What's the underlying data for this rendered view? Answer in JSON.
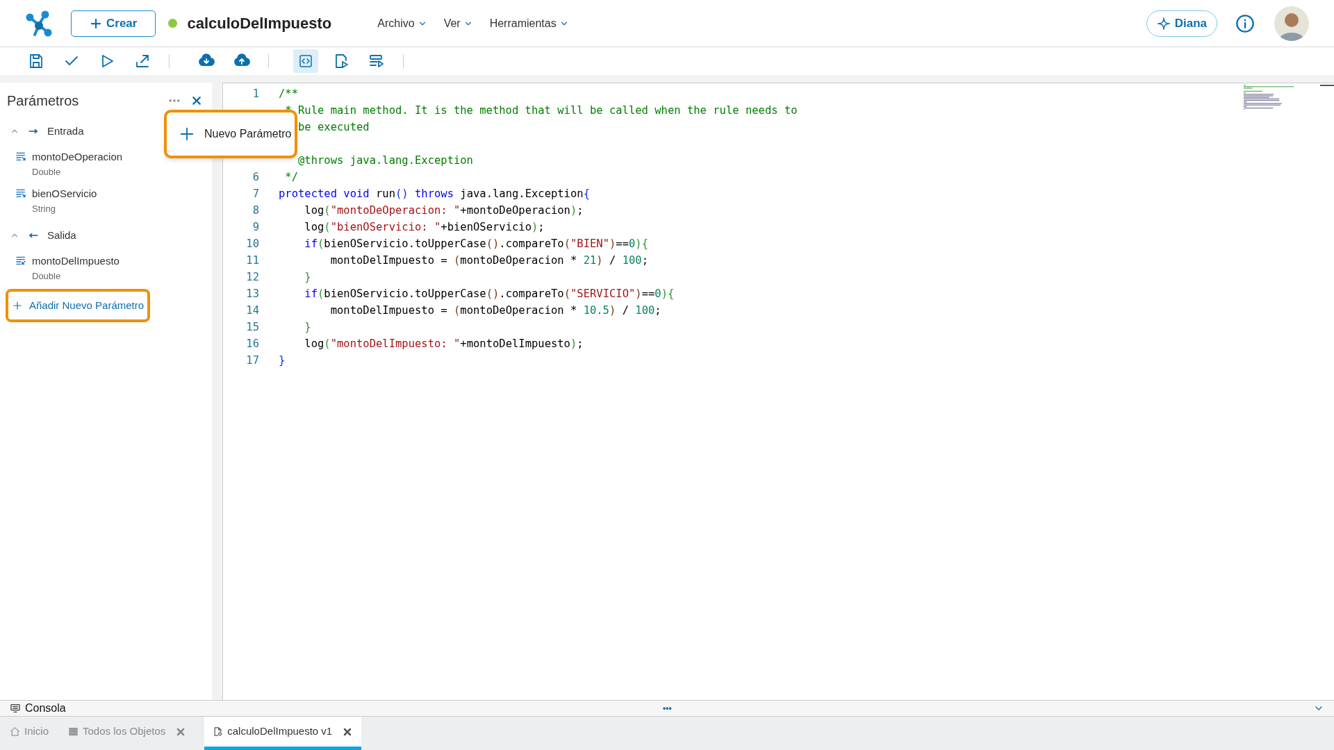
{
  "header": {
    "create_button": "Crear",
    "document": {
      "title": "calculoDelImpuesto",
      "status": {
        "color": "#8dc63f"
      }
    },
    "menus": [
      {
        "label": "Archivo"
      },
      {
        "label": "Ver"
      },
      {
        "label": "Herramientas"
      }
    ],
    "assistant_button": "Diana"
  },
  "toolbar": [
    [
      {
        "kind": "save"
      },
      {
        "kind": "check"
      },
      {
        "kind": "run"
      },
      {
        "kind": "export"
      }
    ],
    [
      {
        "kind": "download"
      },
      {
        "kind": "upload"
      }
    ],
    [
      {
        "kind": "code",
        "selected": true
      },
      {
        "kind": "doc-run",
        "selected": false
      },
      {
        "kind": "list-run",
        "selected": false
      }
    ]
  ],
  "parameters_panel": {
    "title": "Parámetros",
    "groups": [
      {
        "label": "Entrada",
        "kind": "in",
        "expanded": true,
        "children": [
          {
            "name": "montoDeOperacion",
            "type": "Double"
          },
          {
            "name": "bienOServicio",
            "type": "String"
          }
        ]
      },
      {
        "label": "Salida",
        "kind": "out",
        "expanded": true,
        "children": [
          {
            "name": "montoDelImpuesto",
            "type": "Double"
          }
        ]
      }
    ],
    "add_button": {
      "label": "Añadir Nuevo Parámetro",
      "highlighted": true
    },
    "popup_menu": {
      "label": "Nuevo Parámetro",
      "highlighted": true
    }
  },
  "editor": {
    "lines": [
      {
        "kind": "code",
        "number": "1",
        "tokens": [
          {
            "text": "/**",
            "kind": "c"
          }
        ]
      },
      {
        "kind": "code",
        "tokens": [
          {
            "text": " * Rule main method. It is the method that will be called when the rule needs to",
            "kind": "c"
          }
        ]
      },
      {
        "kind": "code",
        "tokens": [
          {
            "text": "   be executed",
            "kind": "c"
          }
        ]
      },
      {
        "kind": "blank"
      },
      {
        "kind": "code",
        "tokens": [
          {
            "text": "   @throws java.lang.Exception",
            "kind": "c"
          }
        ]
      },
      {
        "kind": "code",
        "number": "6",
        "tokens": [
          {
            "text": " */",
            "kind": "c"
          }
        ]
      },
      {
        "kind": "code",
        "number": "7",
        "tokens": [
          {
            "text": "protected void",
            "kind": "k"
          },
          {
            "text": " run",
            "kind": "p"
          },
          {
            "text": "()",
            "kind": "b1"
          },
          {
            "text": " throws",
            "kind": "k"
          },
          {
            "text": " java.lang.Exception",
            "kind": "p"
          },
          {
            "text": "{",
            "kind": "b1"
          }
        ]
      },
      {
        "kind": "code",
        "number": "8",
        "tokens": [
          {
            "text": "    log",
            "kind": "p"
          },
          {
            "text": "(",
            "kind": "b2"
          },
          {
            "text": "\"montoDeOperacion: \"",
            "kind": "s"
          },
          {
            "text": "+montoDeOperacion",
            "kind": "p"
          },
          {
            "text": ")",
            "kind": "b2"
          },
          {
            "text": ";",
            "kind": "p"
          }
        ]
      },
      {
        "kind": "code",
        "number": "9",
        "tokens": [
          {
            "text": "    log",
            "kind": "p"
          },
          {
            "text": "(",
            "kind": "b2"
          },
          {
            "text": "\"bienOServicio: \"",
            "kind": "s"
          },
          {
            "text": "+bienOServicio",
            "kind": "p"
          },
          {
            "text": ")",
            "kind": "b2"
          },
          {
            "text": ";",
            "kind": "p"
          }
        ]
      },
      {
        "kind": "code",
        "number": "10",
        "tokens": [
          {
            "text": "    if",
            "kind": "k"
          },
          {
            "text": "(",
            "kind": "b2"
          },
          {
            "text": "bienOServicio.toUpperCase",
            "kind": "p"
          },
          {
            "text": "()",
            "kind": "b3"
          },
          {
            "text": ".compareTo",
            "kind": "p"
          },
          {
            "text": "(",
            "kind": "b3"
          },
          {
            "text": "\"BIEN\"",
            "kind": "s"
          },
          {
            "text": ")",
            "kind": "b3"
          },
          {
            "text": "==",
            "kind": "p"
          },
          {
            "text": "0",
            "kind": "n"
          },
          {
            "text": "){",
            "kind": "b2"
          }
        ]
      },
      {
        "kind": "code",
        "number": "11",
        "tokens": [
          {
            "text": "        montoDelImpuesto = ",
            "kind": "p"
          },
          {
            "text": "(",
            "kind": "b3"
          },
          {
            "text": "montoDeOperacion * ",
            "kind": "p"
          },
          {
            "text": "21",
            "kind": "n"
          },
          {
            "text": ")",
            "kind": "b3"
          },
          {
            "text": " / ",
            "kind": "p"
          },
          {
            "text": "100",
            "kind": "n"
          },
          {
            "text": ";",
            "kind": "p"
          }
        ]
      },
      {
        "kind": "code",
        "number": "12",
        "tokens": [
          {
            "text": "    }",
            "kind": "b2"
          }
        ]
      },
      {
        "kind": "code",
        "number": "13",
        "tokens": [
          {
            "text": "    if",
            "kind": "k"
          },
          {
            "text": "(",
            "kind": "b2"
          },
          {
            "text": "bienOServicio.toUpperCase",
            "kind": "p"
          },
          {
            "text": "()",
            "kind": "b3"
          },
          {
            "text": ".compareTo",
            "kind": "p"
          },
          {
            "text": "(",
            "kind": "b3"
          },
          {
            "text": "\"SERVICIO\"",
            "kind": "s"
          },
          {
            "text": ")",
            "kind": "b3"
          },
          {
            "text": "==",
            "kind": "p"
          },
          {
            "text": "0",
            "kind": "n"
          },
          {
            "text": "){",
            "kind": "b2"
          }
        ]
      },
      {
        "kind": "code",
        "number": "14",
        "tokens": [
          {
            "text": "        montoDelImpuesto = ",
            "kind": "p"
          },
          {
            "text": "(",
            "kind": "b3"
          },
          {
            "text": "montoDeOperacion * ",
            "kind": "p"
          },
          {
            "text": "10.5",
            "kind": "n"
          },
          {
            "text": ")",
            "kind": "b3"
          },
          {
            "text": " / ",
            "kind": "p"
          },
          {
            "text": "100",
            "kind": "n"
          },
          {
            "text": ";",
            "kind": "p"
          }
        ]
      },
      {
        "kind": "code",
        "number": "15",
        "tokens": [
          {
            "text": "    }",
            "kind": "b2"
          }
        ]
      },
      {
        "kind": "code",
        "number": "16",
        "tokens": [
          {
            "text": "    log",
            "kind": "p"
          },
          {
            "text": "(",
            "kind": "b2"
          },
          {
            "text": "\"montoDelImpuesto: \"",
            "kind": "s"
          },
          {
            "text": "+montoDelImpuesto",
            "kind": "p"
          },
          {
            "text": ")",
            "kind": "b2"
          },
          {
            "text": ";",
            "kind": "p"
          }
        ]
      },
      {
        "kind": "code",
        "number": "17",
        "tokens": [
          {
            "text": "}",
            "kind": "b1"
          }
        ]
      }
    ]
  },
  "console": {
    "label": "Consola",
    "menu": "•••"
  },
  "tabs": [
    {
      "label": "Inicio",
      "kind": "home",
      "closable": false,
      "selected": false
    },
    {
      "label": "Todos los Objetos",
      "kind": "list",
      "closable": true,
      "selected": false
    },
    {
      "label": "calculoDelImpuesto v1",
      "kind": "doc",
      "closable": true,
      "selected": true
    }
  ]
}
